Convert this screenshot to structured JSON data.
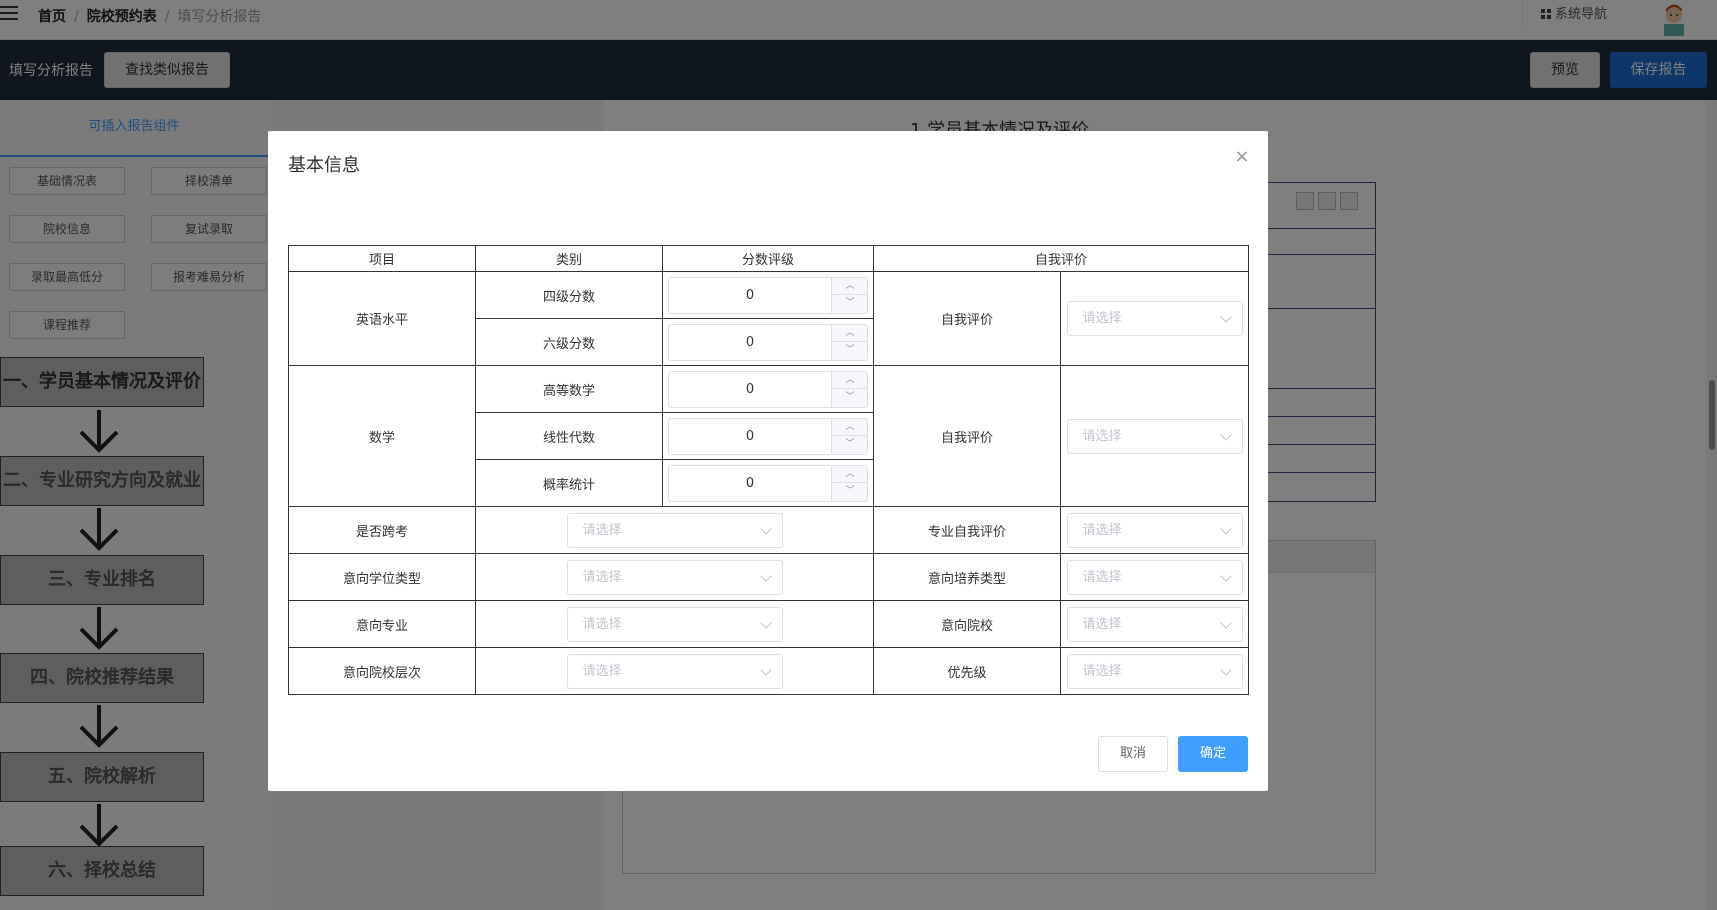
{
  "topnav": {
    "crumbs": [
      "首页",
      "院校预约表",
      "填写分析报告"
    ],
    "system_nav": "系统导航"
  },
  "toolbar": {
    "title": "填写分析报告",
    "find_similar": "查找类似报告",
    "preview": "预览",
    "save": "保存报告"
  },
  "sidebar": {
    "components_title": "可插入报告组件",
    "components": [
      "基础情况表",
      "择校清单",
      "院校信息",
      "复试录取",
      "录取最高低分",
      "报考难易分析",
      "课程推荐"
    ],
    "steps": [
      "一、学员基本情况及评价",
      "二、专业研究方向及就业",
      "三、专业排名",
      "四、院校推荐结果",
      "五、院校解析",
      "六、择校总结"
    ]
  },
  "paper": {
    "title": "1.学员基本情况及评价"
  },
  "modal": {
    "title": "基本信息",
    "close": "×",
    "headers": [
      "项目",
      "类别",
      "分数评级",
      "自我评价"
    ],
    "english": {
      "label": "英语水平",
      "cet4_label": "四级分数",
      "cet4_value": "0",
      "cet6_label": "六级分数",
      "cet6_value": "0",
      "self_label": "自我评价",
      "self_placeholder": "请选择"
    },
    "math": {
      "label": "数学",
      "adv_label": "高等数学",
      "adv_value": "0",
      "linear_label": "线性代数",
      "linear_value": "0",
      "prob_label": "概率统计",
      "prob_value": "0",
      "self_label": "自我评价",
      "self_placeholder": "请选择"
    },
    "rows": [
      {
        "left_label": "是否跨考",
        "left_placeholder": "请选择",
        "right_label": "专业自我评价",
        "right_placeholder": "请选择"
      },
      {
        "left_label": "意向学位类型",
        "left_placeholder": "请选择",
        "right_label": "意向培养类型",
        "right_placeholder": "请选择"
      },
      {
        "left_label": "意向专业",
        "left_placeholder": "请选择",
        "right_label": "意向院校",
        "right_placeholder": "请选择"
      },
      {
        "left_label": "意向院校层次",
        "left_placeholder": "请选择",
        "right_label": "优先级",
        "right_placeholder": "请选择"
      }
    ],
    "spin_up": "︿",
    "spin_down": "﹀",
    "cancel": "取消",
    "confirm": "确定"
  },
  "colors": {
    "primary": "#409eff",
    "toolbar_bg": "#1f2d3d",
    "save_button": "#1f6cd0"
  }
}
